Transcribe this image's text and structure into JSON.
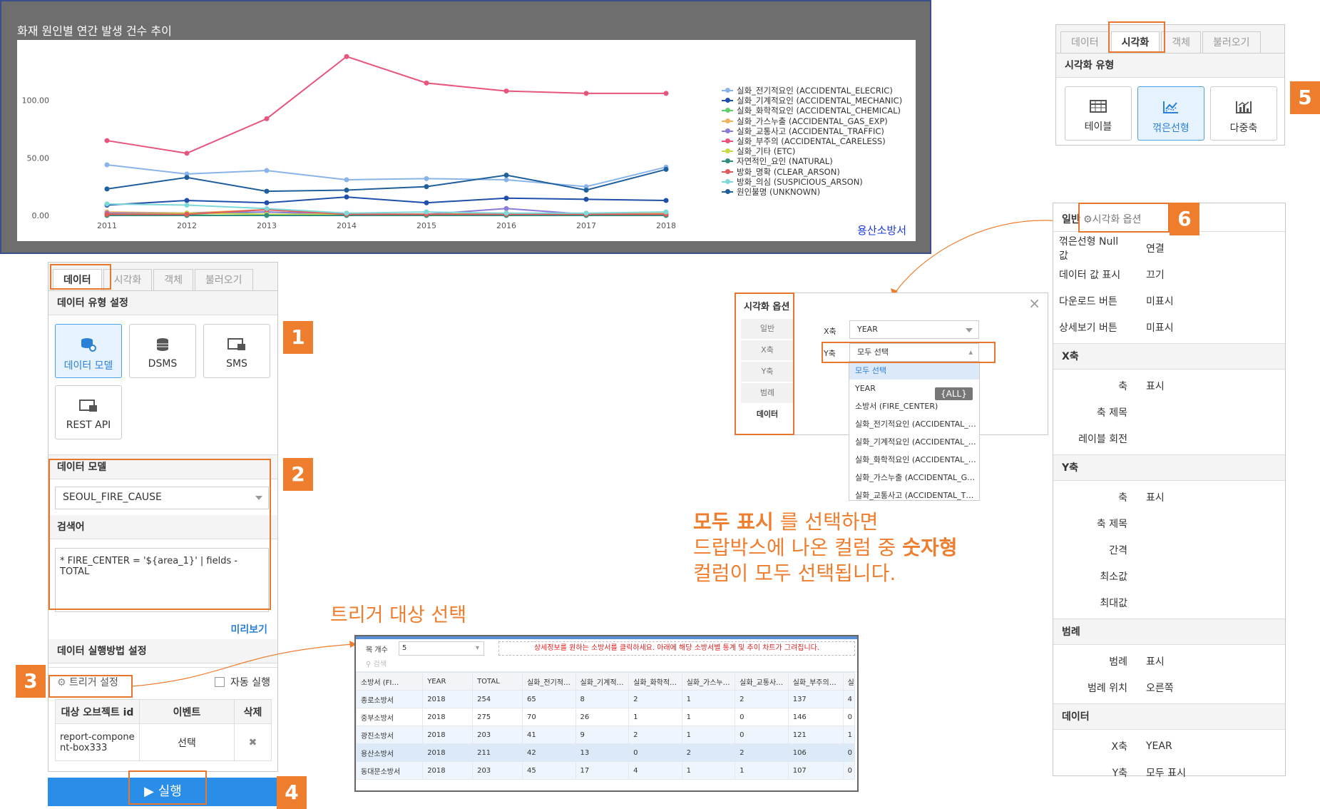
{
  "chart_panel": {
    "title": "화재 원인별 연간 발생 건수 추이",
    "footer": "용산소방서"
  },
  "chart_data": {
    "type": "line",
    "title": "화재 원인별 연간 발생 건수 추이",
    "x": [
      2011,
      2012,
      2013,
      2014,
      2015,
      2016,
      2017,
      2018
    ],
    "ylim": [
      0,
      140
    ],
    "yticks": [
      "0.00",
      "50.00",
      "100.00"
    ],
    "legend_position": "right",
    "grid": false,
    "series": [
      {
        "name": "실화_전기적요인 (ACCIDENTAL_ELECRIC)",
        "color": "#8ab4e8",
        "values": [
          44,
          36,
          39,
          31,
          32,
          31,
          25,
          42
        ]
      },
      {
        "name": "실화_기계적요인 (ACCIDENTAL_MECHANIC)",
        "color": "#1f4fa8",
        "values": [
          9,
          13,
          11,
          16,
          11,
          15,
          14,
          13
        ]
      },
      {
        "name": "실화_화학적요인 (ACCIDENTAL_CHEMICAL)",
        "color": "#5fd06a",
        "values": [
          2,
          1,
          3,
          1,
          1,
          1,
          1,
          2
        ]
      },
      {
        "name": "실화_가스누출 (ACCIDENTAL_GAS_EXP)",
        "color": "#f2b25a",
        "values": [
          3,
          2,
          5,
          1,
          1,
          1,
          1,
          2
        ]
      },
      {
        "name": "실화_교통사고 (ACCIDENTAL_TRAFFIC)",
        "color": "#8a7bd8",
        "values": [
          2,
          2,
          3,
          1,
          1,
          6,
          1,
          1
        ]
      },
      {
        "name": "실화_부주의 (ACCIDENTAL_CARELESS)",
        "color": "#e8557c",
        "values": [
          65,
          54,
          84,
          138,
          115,
          108,
          106,
          106
        ]
      },
      {
        "name": "실화_기타 (ETC)",
        "color": "#c9d94a",
        "values": [
          1,
          2,
          1,
          1,
          1,
          2,
          1,
          1
        ]
      },
      {
        "name": "자연적인_요인 (NATURAL)",
        "color": "#2e8f80",
        "values": [
          0,
          0,
          0,
          0,
          0,
          0,
          0,
          0
        ]
      },
      {
        "name": "방화_명확 (CLEAR_ARSON)",
        "color": "#e05a5a",
        "values": [
          1,
          1,
          5,
          1,
          1,
          1,
          1,
          1
        ]
      },
      {
        "name": "방화_의심 (SUSPICIOUS_ARSON)",
        "color": "#7fd8d8",
        "values": [
          10,
          9,
          6,
          2,
          3,
          2,
          2,
          3
        ]
      },
      {
        "name": "원인불명 (UNKNOWN)",
        "color": "#1f5f9c",
        "values": [
          23,
          33,
          21,
          22,
          25,
          35,
          22,
          40
        ]
      }
    ]
  },
  "data_panel": {
    "tabs": [
      "데이터",
      "시각화",
      "객체",
      "불러오기"
    ],
    "data_type_header": "데이터 유형 설정",
    "types": [
      {
        "label": "데이터 모델",
        "icon": "data-model-icon"
      },
      {
        "label": "DSMS",
        "icon": "database-icon"
      },
      {
        "label": "SMS",
        "icon": "sms-icon"
      },
      {
        "label": "REST API",
        "icon": "rest-api-icon"
      }
    ],
    "model_header": "데이터 모델",
    "model_value": "SEOUL_FIRE_CAUSE",
    "query_header": "검색어",
    "query_value": "* FIRE_CENTER = '${area_1}' | fields -TOTAL",
    "preview_link": "미리보기",
    "exec_header": "데이터 실행방법 설정",
    "trigger_label": "트리거 설정",
    "auto_run_label": "자동 실행",
    "table_headers": [
      "대상 오브젝트 id",
      "이벤트",
      "삭제"
    ],
    "table_row": {
      "id": "report-component-box333",
      "event": "선택",
      "delete": "✖"
    },
    "run_button": "▶ 실행"
  },
  "badges": [
    "1",
    "2",
    "3",
    "4",
    "5",
    "6"
  ],
  "trigger_caption": "트리거 대상 선택",
  "grid": {
    "count_label": "목 개수",
    "count_value": "5",
    "notice": "상세정보를 원하는 소방서를 클릭하세요. 아래에 해당 소방서별 통계 및 추이 차트가 그려집니다.",
    "search_placeholder": "검색",
    "headers": [
      "소방서 (FI…",
      "YEAR",
      "TOTAL",
      "실화_전기적…",
      "실화_기계적…",
      "실화_화학적…",
      "실화_가스누…",
      "실화_교통사…",
      "실화_부주의…",
      "실화"
    ],
    "rows": [
      [
        "종로소방서",
        "2018",
        "254",
        "65",
        "8",
        "2",
        "1",
        "2",
        "137",
        "4"
      ],
      [
        "중부소방서",
        "2018",
        "275",
        "70",
        "26",
        "1",
        "1",
        "0",
        "146",
        "0"
      ],
      [
        "광진소방서",
        "2018",
        "203",
        "41",
        "9",
        "2",
        "1",
        "0",
        "121",
        "1"
      ],
      [
        "용산소방서",
        "2018",
        "211",
        "42",
        "13",
        "0",
        "2",
        "2",
        "106",
        "0"
      ],
      [
        "동대문소방서",
        "2018",
        "203",
        "45",
        "17",
        "4",
        "1",
        "1",
        "107",
        "0"
      ]
    ]
  },
  "viz_panel": {
    "tabs": [
      "데이터",
      "시각화",
      "객체",
      "불러오기"
    ],
    "header": "시각화 유형",
    "types": [
      {
        "label": "테이블",
        "icon": "table-icon"
      },
      {
        "label": "꺾은선형",
        "icon": "line-chart-icon"
      },
      {
        "label": "다중축",
        "icon": "multi-axis-icon"
      }
    ]
  },
  "options_dialog": {
    "title": "시각화 옵션",
    "side_items": [
      "일반",
      "X축",
      "Y축",
      "범례",
      "데이터"
    ],
    "x_label": "X축",
    "x_value": "YEAR",
    "y_label": "Y축",
    "y_value": "모두 선택",
    "dropdown": [
      "모두 선택",
      "YEAR",
      "소방서 (FIRE_CENTER)",
      "실화_전기적요인 (ACCIDENTAL_…",
      "실화_기계적요인 (ACCIDENTAL_…",
      "실화_화학적요인 (ACCIDENTAL_…",
      "실화_가스누출 (ACCIDENTAL_G…",
      "실화_교통사고 (ACCIDENTAL_T…"
    ],
    "tooltip": "{ALL}",
    "close": "×"
  },
  "note": {
    "line1_bold": "모두 표시",
    "line1_rest": " 를 선택하면",
    "line2_start": "드랍박스에 나온 컬럼 중 ",
    "line2_bold": "숫자형",
    "line3": "컬럼이 모두 선택됩니다."
  },
  "props_panel": {
    "tab_general": "일반",
    "tab_options": "시각화 옵션",
    "general": [
      {
        "k": "꺾은선형 Null 값",
        "v": "연결"
      },
      {
        "k": "데이터 값 표시",
        "v": "끄기"
      },
      {
        "k": "다운로드 버튼",
        "v": "미표시"
      },
      {
        "k": "상세보기 버튼",
        "v": "미표시"
      }
    ],
    "x_head": "X축",
    "x_rows": [
      {
        "k": "축",
        "v": "표시"
      },
      {
        "k": "축 제목",
        "v": ""
      },
      {
        "k": "레이블 회전",
        "v": ""
      }
    ],
    "y_head": "Y축",
    "y_rows": [
      {
        "k": "축",
        "v": "표시"
      },
      {
        "k": "축 제목",
        "v": ""
      },
      {
        "k": "간격",
        "v": ""
      },
      {
        "k": "최소값",
        "v": ""
      },
      {
        "k": "최대값",
        "v": ""
      }
    ],
    "legend_head": "범례",
    "legend_rows": [
      {
        "k": "범례",
        "v": "표시"
      },
      {
        "k": "범례 위치",
        "v": "오른쪽"
      }
    ],
    "data_head": "데이터",
    "data_rows": [
      {
        "k": "X축",
        "v": "YEAR"
      },
      {
        "k": "Y축",
        "v": "모두 표시"
      }
    ]
  }
}
